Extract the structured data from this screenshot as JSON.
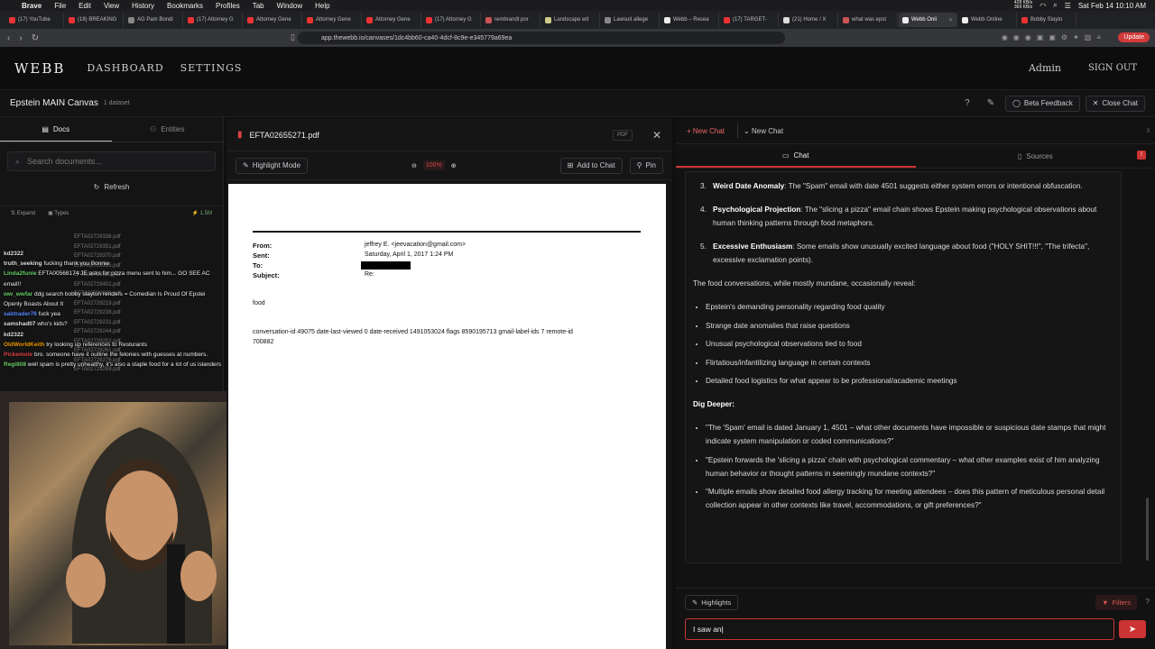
{
  "menubar": {
    "app": "Brave",
    "items": [
      "File",
      "Edit",
      "View",
      "History",
      "Bookmarks",
      "Profiles",
      "Tab",
      "Window",
      "Help"
    ],
    "net_up": "428 KB/s",
    "net_down": "369 KB/s",
    "clock": "Sat Feb 14  10:10 AM"
  },
  "tabs": [
    {
      "label": "(17) YouTube",
      "color": "#e33"
    },
    {
      "label": "(18) BREAKING",
      "color": "#e33"
    },
    {
      "label": "AG Pam Bondi",
      "color": "#888"
    },
    {
      "label": "(17) Attorney G",
      "color": "#e33"
    },
    {
      "label": "Attorney Gene",
      "color": "#e33"
    },
    {
      "label": "Attorney Gene",
      "color": "#e33"
    },
    {
      "label": "Attorney Gene",
      "color": "#e33"
    },
    {
      "label": "(17) Attorney G",
      "color": "#e33"
    },
    {
      "label": "rembrandt por",
      "color": "#c55"
    },
    {
      "label": "Landscape wit",
      "color": "#cc8"
    },
    {
      "label": "Lawsuit allege",
      "color": "#888"
    },
    {
      "label": "Webb – Resea",
      "color": "#eee"
    },
    {
      "label": "(17) TARGET-",
      "color": "#e33"
    },
    {
      "label": "(21) Home / X",
      "color": "#ddd"
    },
    {
      "label": "what was epst",
      "color": "#c55"
    },
    {
      "label": "Webb Onli",
      "color": "#eee",
      "active": true
    },
    {
      "label": "Webb Online",
      "color": "#eee"
    },
    {
      "label": "Bobby Slayto",
      "color": "#e33"
    }
  ],
  "address": {
    "url": "app.thewebb.io/canvases/1dc4bb60-ca40-4dcf-8c9e-e345779a69ea",
    "update": "Update"
  },
  "header": {
    "logo": "WEBB",
    "nav": [
      "DASHBOARD",
      "SETTINGS"
    ],
    "admin": "Admin",
    "signout": "SIGN OUT"
  },
  "canvas": {
    "title": "Epstein MAIN Canvas",
    "datasets": "1 dataset",
    "beta": "Beta Feedback",
    "close_chat": "Close Chat"
  },
  "left": {
    "tab_docs": "Docs",
    "tab_entities": "Entities",
    "search_placeholder": "Search documents...",
    "refresh": "Refresh",
    "expand": "Expand",
    "types": "Types",
    "size": "1.5M",
    "files": [
      "EFTA02729336.pdf",
      "EFTA02729351.pdf",
      "EFTA02729370.pdf",
      "EFTA02729385.pdf",
      "EFTA02729392.pdf",
      "EFTA02729402.pdf",
      "EFTA02729080.pdf",
      "EFTA02729219.pdf",
      "EFTA02729238.pdf",
      "EFTA02729231.pdf",
      "EFTA02729244.pdf",
      "EFTA02729252.pdf",
      "EFTA02729261.pdf",
      "EFTA02729276.pdf",
      "EFTA02729289.pdf"
    ]
  },
  "stream_chat": [
    {
      "user": "kd2322",
      "color": "#ddd",
      "text": ""
    },
    {
      "user": "truth_seeking",
      "color": "#ddd",
      "text": "fucking thank you Bonnie"
    },
    {
      "user": "Linda2funie",
      "color": "#6c6",
      "text": "EFTA00568174 JE asks for pizza menu sent to him... GO SEE AC"
    },
    {
      "user": "",
      "color": "#ddd",
      "text": "email!!"
    },
    {
      "user": "ww_wwfar",
      "color": "#6c6",
      "text": "ddg search bobby slayton renders = Comedian Is Proud Of Epstei"
    },
    {
      "user": "",
      "color": "#ddd",
      "text": "Openly Boasts About It"
    },
    {
      "user": "sabtrader76",
      "color": "#58f",
      "text": "fuck yea"
    },
    {
      "user": "samshad07",
      "color": "#ddd",
      "text": "who's kids?"
    },
    {
      "user": "kd2322",
      "color": "#ddd",
      "text": ""
    },
    {
      "user": "OldWorldKeith",
      "color": "#e90",
      "text": "try looking up references to Resturants"
    },
    {
      "user": "Pickemole",
      "color": "#d44",
      "text": "bro. someone have it outline the felonies with guesses at numbers."
    },
    {
      "user": "Regi808",
      "color": "#6c6",
      "text": "well spam is pretty unhealthy, it's also a staple food for a lot of us islanders"
    }
  ],
  "pdf": {
    "filename": "EFTA02655271.pdf",
    "tag": "PDF",
    "highlight_mode": "Highlight Mode",
    "zoom": "100%",
    "add_to_chat": "Add to Chat",
    "pin": "Pin",
    "from_label": "From:",
    "from_value": "jeffrey E. <jeevacation@gmail.com>",
    "sent_label": "Sent:",
    "sent_value": "Saturday, April 1, 2017 1:24 PM",
    "to_label": "To:",
    "subject_label": "Subject:",
    "subject_value": "Re:",
    "body": "food",
    "meta_line1": "conversation-id 49075 date-last-viewed 0 date-received 1491053024 flags 8590195713 gmail-label-ids 7 remote-id",
    "meta_line2": "700882"
  },
  "chat": {
    "new_chat_btn": "New Chat",
    "new_chat_tab": "New Chat",
    "count": "3",
    "tab_chat": "Chat",
    "tab_sources": "Sources",
    "numbered": [
      {
        "n": "3.",
        "bold": "Weird Date Anomaly",
        "text": ": The \"Spam\" email with date 4501 suggests either system errors or intentional obfuscation."
      },
      {
        "n": "4.",
        "bold": "Psychological Projection",
        "text": ": The \"slicing a pizza\" email chain shows Epstein making psychological observations about human thinking patterns through food metaphors."
      },
      {
        "n": "5.",
        "bold": "Excessive Enthusiasm",
        "text": ": Some emails show unusually excited language about food (\"HOLY SHIT!!!\", \"The trifecta\", excessive exclamation points)."
      }
    ],
    "para": "The food conversations, while mostly mundane, occasionally reveal:",
    "bullets": [
      "Epstein's demanding personality regarding food quality",
      "Strange date anomalies that raise questions",
      "Unusual psychological observations tied to food",
      "Flirtatious/infantilizing language in certain contexts",
      "Detailed food logistics for what appear to be professional/academic meetings"
    ],
    "dig_title": "Dig Deeper:",
    "dig": [
      "\"The 'Spam' email is dated January 1, 4501 – what other documents have impossible or suspicious date stamps that might indicate system manipulation or coded communications?\"",
      "\"Epstein forwards the 'slicing a pizza' chain with psychological commentary – what other examples exist of him analyzing human behavior or thought patterns in seemingly mundane contexts?\"",
      "\"Multiple emails show detailed food allergy tracking for meeting attendees – does this pattern of meticulous personal detail collection appear in other contexts like travel, accommodations, or gift preferences?\""
    ],
    "highlights": "Highlights",
    "filters": "Filters",
    "input_value": "I saw an"
  }
}
